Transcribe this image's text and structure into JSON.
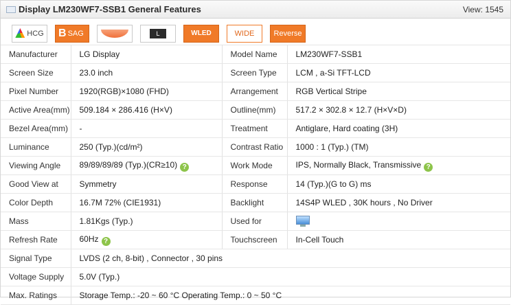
{
  "header": {
    "title": "Display LM230WF7-SSB1 General Features",
    "views": "View: 1545"
  },
  "badges": {
    "hcg": "HCG",
    "sag_letter": "B",
    "sag": "SAG",
    "l": "L",
    "wled": "WLED",
    "wide": "WIDE",
    "reverse": "Reverse"
  },
  "specs": {
    "r0": {
      "k1": "Manufacturer",
      "v1": "LG Display",
      "k2": "Model Name",
      "v2": "LM230WF7-SSB1"
    },
    "r1": {
      "k1": "Screen Size",
      "v1": "23.0 inch",
      "k2": "Screen Type",
      "v2": "LCM ,   a-Si TFT-LCD"
    },
    "r2": {
      "k1": "Pixel Number",
      "v1": "1920(RGB)×1080   (FHD)",
      "k2": "Arrangement",
      "v2": "RGB Vertical Stripe"
    },
    "r3": {
      "k1": "Active Area(mm)",
      "v1": "509.184 × 286.416 (H×V)",
      "k2": "Outline(mm)",
      "v2": "517.2 × 302.8 × 12.7 (H×V×D)"
    },
    "r4": {
      "k1": "Bezel Area(mm)",
      "v1": "-",
      "k2": "Treatment",
      "v2": "Antiglare, Hard coating (3H)"
    },
    "r5": {
      "k1": "Luminance",
      "v1": "250 (Typ.)(cd/m²)",
      "k2": "Contrast Ratio",
      "v2": "1000 : 1 (Typ.) (TM)"
    },
    "r6": {
      "k1": "Viewing Angle",
      "v1": "89/89/89/89 (Typ.)(CR≥10)",
      "k2": "Work Mode",
      "v2": "IPS, Normally Black, Transmissive"
    },
    "r7": {
      "k1": "Good View at",
      "v1": "Symmetry",
      "k2": "Response",
      "v2": "14 (Typ.)(G to G) ms"
    },
    "r8": {
      "k1": "Color Depth",
      "v1": "16.7M   72% (CIE1931)",
      "k2": "Backlight",
      "v2": "14S4P WLED , 30K hours , No Driver"
    },
    "r9": {
      "k1": "Mass",
      "v1": "1.81Kgs (Typ.)",
      "k2": "Used for",
      "v2_icon": "monitor-icon"
    },
    "r10": {
      "k1": "Refresh Rate",
      "v1": "60Hz",
      "k2": "Touchscreen",
      "v2": "In-Cell Touch"
    },
    "r11": {
      "k1": "Signal Type",
      "v1": "LVDS (2 ch, 8-bit) , Connector , 30 pins"
    },
    "r12": {
      "k1": "Voltage Supply",
      "v1": "5.0V (Typ.)"
    },
    "r13": {
      "k1": "Max. Ratings",
      "v1": "Storage Temp.: -20 ~ 60 °C    Operating Temp.: 0 ~ 50 °C"
    }
  },
  "help_glyph": "?"
}
